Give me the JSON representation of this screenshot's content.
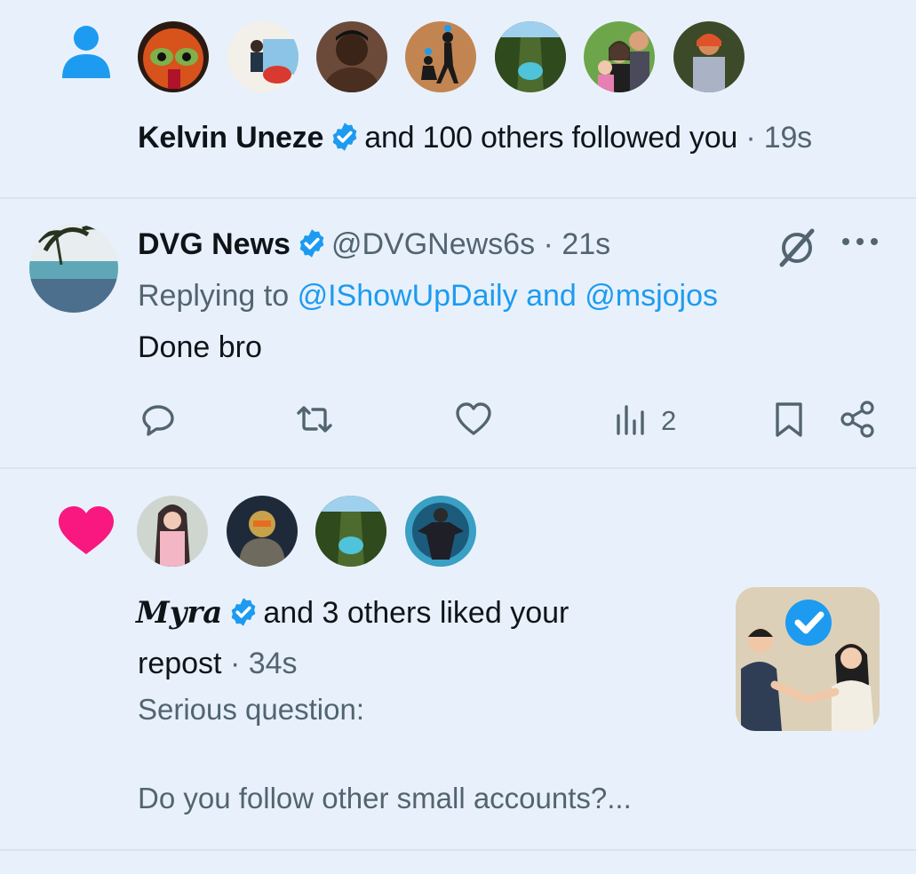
{
  "follow_notification": {
    "actor_name": "Kelvin Uneze",
    "text": "and 100 others followed you",
    "separator": "·",
    "time": "19s"
  },
  "tweet": {
    "display_name": "DVG News",
    "handle": "@DVGNews6s",
    "separator": "·",
    "time": "21s",
    "replying_prefix": "Replying to",
    "reply_user1": "@IShowUpDaily",
    "reply_and": "and",
    "reply_user2": "@msjojos",
    "body": "Done bro",
    "views_count": "2"
  },
  "like_notification": {
    "actor_name": "Myra",
    "text_line1": "and 3 others liked your",
    "text_line2": "repost",
    "separator": "·",
    "time": "34s",
    "preview_line1": "Serious question:",
    "preview_line2": "Do you follow other small accounts?..."
  },
  "colors": {
    "background": "#e8f1fb",
    "accent_blue": "#1d9bf0",
    "like_pink": "#f91880",
    "muted_text": "#536471"
  },
  "icons": [
    "person-icon",
    "verified-icon",
    "grok-icon",
    "more-icon",
    "reply-icon",
    "retweet-icon",
    "like-icon",
    "views-icon",
    "bookmark-icon",
    "share-icon",
    "heart-icon"
  ]
}
